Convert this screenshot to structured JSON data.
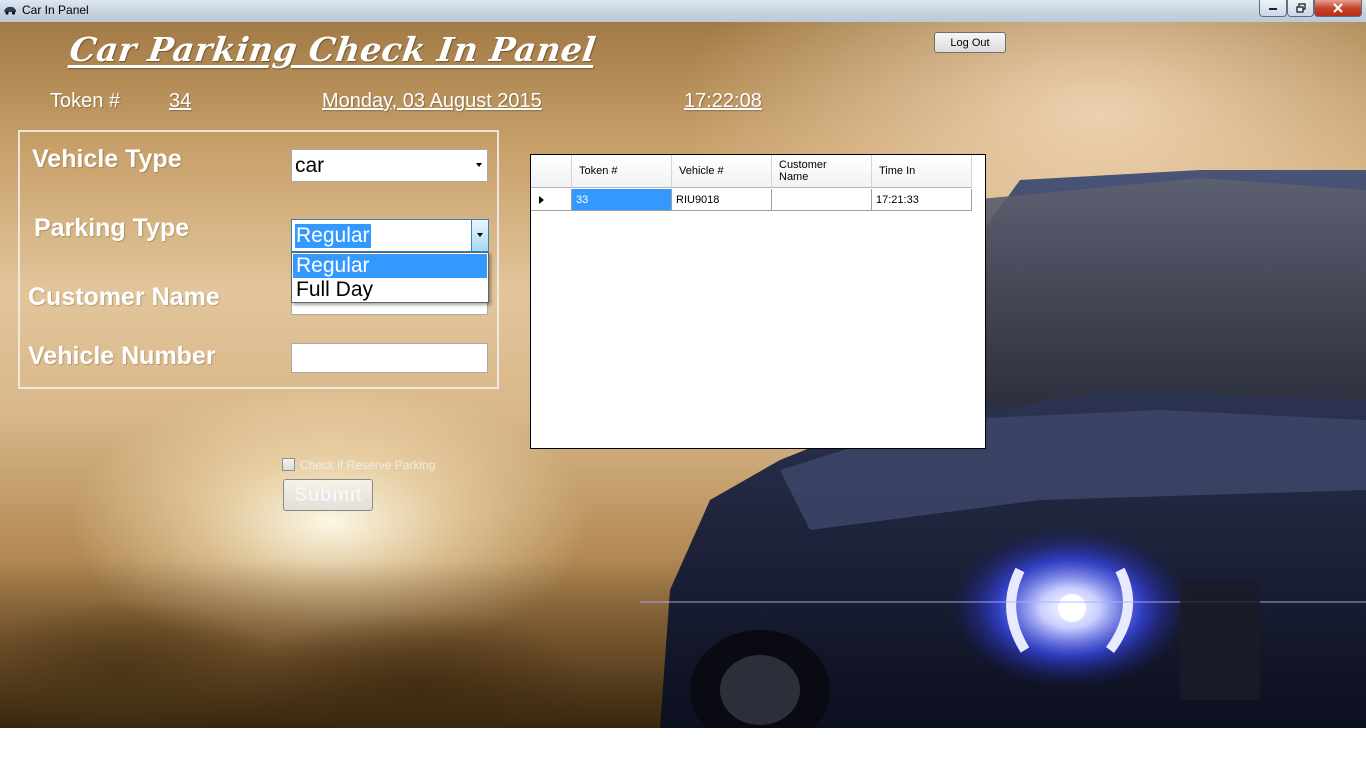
{
  "window": {
    "title": "Car In Panel"
  },
  "header": {
    "panel_title": "Car Parking Check In Panel",
    "token_label": "Token #",
    "token_value": "34",
    "date": "Monday, 03 August 2015",
    "time": "17:22:08",
    "logout_label": "Log Out"
  },
  "form": {
    "vehicle_type_label": "Vehicle Type",
    "vehicle_type_value": "car",
    "parking_type_label": "Parking Type",
    "parking_type_value": "Regular",
    "parking_type_options": [
      "Regular",
      "Full Day"
    ],
    "customer_name_label": "Customer Name",
    "customer_name_value": "",
    "vehicle_number_label": "Vehicle Number",
    "vehicle_number_value": "",
    "reserve_label": "Check if Reserve Parking",
    "reserve_checked": false,
    "submit_label": "Submit"
  },
  "grid": {
    "columns": [
      "Token #",
      "Vehicle #",
      "Customer Name",
      "Time In"
    ],
    "rows": [
      [
        "33",
        "RIU9018",
        "",
        "17:21:33"
      ]
    ]
  },
  "colors": {
    "selection": "#3399ff",
    "close_button": "#c8442d",
    "headlight": "#3b4cff"
  }
}
